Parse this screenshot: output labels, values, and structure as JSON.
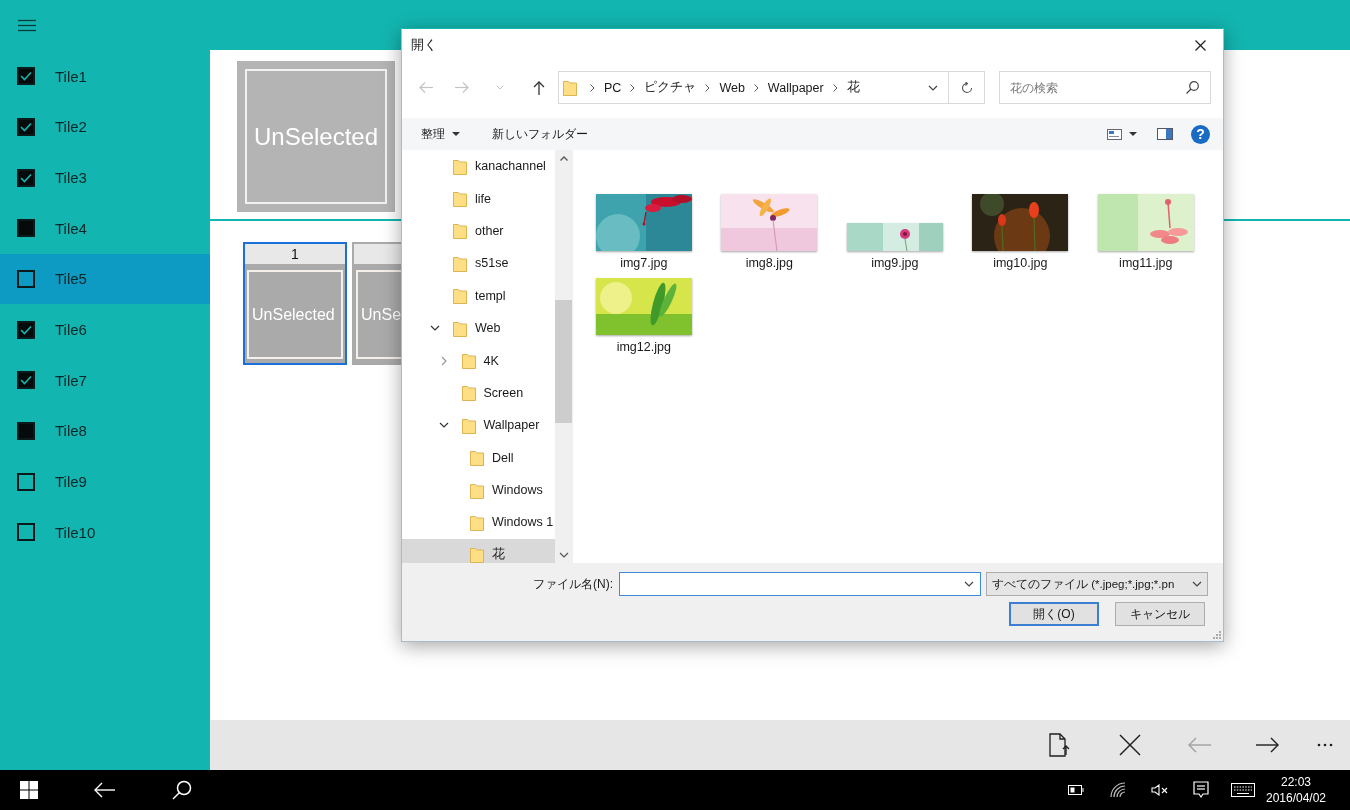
{
  "app": {
    "nav_items": [
      {
        "label": "Tile1",
        "checked": true,
        "selected": false
      },
      {
        "label": "Tile2",
        "checked": true,
        "selected": false
      },
      {
        "label": "Tile3",
        "checked": true,
        "selected": false
      },
      {
        "label": "Tile4",
        "checked": false,
        "indeterminate": true,
        "selected": false
      },
      {
        "label": "Tile5",
        "checked": false,
        "indeterminate": false,
        "selected": true
      },
      {
        "label": "Tile6",
        "checked": true,
        "selected": false
      },
      {
        "label": "Tile7",
        "checked": true,
        "selected": false
      },
      {
        "label": "Tile8",
        "checked": false,
        "indeterminate": true,
        "selected": false
      },
      {
        "label": "Tile9",
        "checked": false,
        "indeterminate": false,
        "selected": false
      },
      {
        "label": "Tile10",
        "checked": false,
        "indeterminate": false,
        "selected": false
      }
    ]
  },
  "preview": {
    "label": "UnSelected"
  },
  "thumbnails": [
    {
      "number": "1",
      "label": "UnSelected",
      "selected": true
    },
    {
      "label": "UnSe",
      "selected": false
    }
  ],
  "command_bar": [
    {
      "kind": "open-file",
      "disabled": false
    },
    {
      "kind": "close",
      "disabled": false
    },
    {
      "kind": "back",
      "disabled": true
    },
    {
      "kind": "forward",
      "disabled": false
    },
    {
      "kind": "more",
      "disabled": false
    }
  ],
  "taskbar": {
    "time": "22:03",
    "date": "2016/04/02"
  },
  "dialog": {
    "title": "開く",
    "nav": [
      {
        "kind": "back",
        "disabled": true
      },
      {
        "kind": "forward",
        "disabled": true
      },
      {
        "kind": "recent",
        "disabled": true
      },
      {
        "kind": "up",
        "disabled": false
      }
    ],
    "path": [
      "PC",
      "ピクチャ",
      "Web",
      "Wallpaper",
      "花"
    ],
    "search": {
      "placeholder": "花の検索"
    },
    "toolbar": {
      "organize": "整理",
      "new_folder": "新しいフォルダー",
      "help": "?"
    },
    "tree": [
      {
        "label": "kanachannel",
        "selected": false
      },
      {
        "label": "life",
        "selected": false
      },
      {
        "label": "other",
        "selected": false
      },
      {
        "label": "s51se",
        "selected": false
      },
      {
        "label": "templ",
        "selected": false
      },
      {
        "label": "Web",
        "expanded": true,
        "selected": false,
        "children": [
          {
            "label": "4K",
            "expanded": false,
            "selected": false
          },
          {
            "label": "Screen",
            "selected": false
          },
          {
            "label": "Wallpaper",
            "expanded": true,
            "selected": false,
            "children": [
              {
                "label": "Dell",
                "selected": false
              },
              {
                "label": "Windows",
                "selected": false
              },
              {
                "label": "Windows 1",
                "selected": false
              },
              {
                "label": "花",
                "selected": true
              }
            ]
          }
        ]
      }
    ],
    "files": [
      {
        "name": "img7.jpg",
        "kind": "picture"
      },
      {
        "name": "img8.jpg",
        "kind": "picture"
      },
      {
        "name": "img9.jpg",
        "kind": "picture"
      },
      {
        "name": "img10.jpg",
        "kind": "picture"
      },
      {
        "name": "img11.jpg",
        "kind": "picture"
      },
      {
        "name": "img12.jpg",
        "kind": "picture"
      }
    ],
    "file_name_label": "ファイル名(N):",
    "file_type": "すべてのファイル (*.jpeg;*.jpg;*.pn",
    "buttons": [
      {
        "label": "開く(O)",
        "default": true
      },
      {
        "label": "キャンセル",
        "default": false
      }
    ]
  }
}
